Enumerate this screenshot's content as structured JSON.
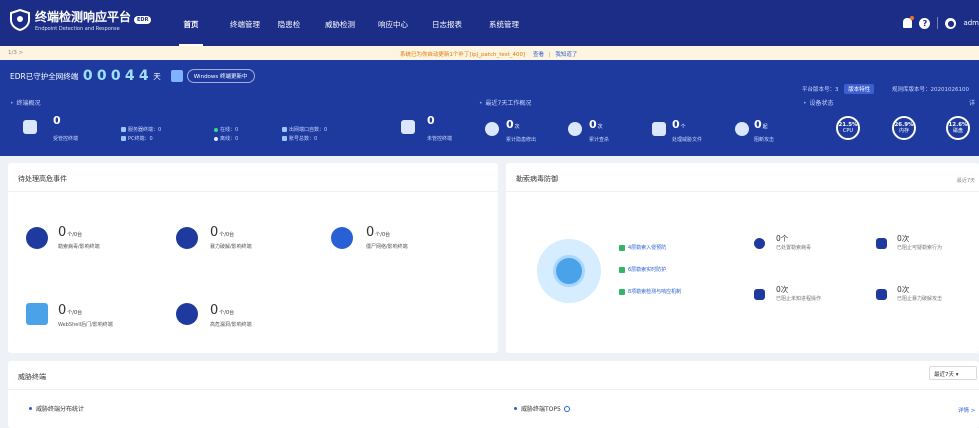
{
  "app": {
    "title": "终端检测响应平台",
    "badge": "EDR",
    "subtitle": "Endpoint Detection and Response"
  },
  "nav": [
    "首页",
    "终端管理",
    "隐患检",
    "威胁检测",
    "响应中心",
    "日志报表",
    "系统管理"
  ],
  "user": {
    "name": "adm"
  },
  "notice": {
    "page": "1/3 >",
    "message": "系统已为你自动更新1个补丁[ipj_patch_test_400]",
    "link1": "查看",
    "link2": "我知道了"
  },
  "banner": {
    "guard_label": "EDR已守护全网终端",
    "digits": [
      "0",
      "0",
      "0",
      "4",
      "4"
    ],
    "days": "天",
    "windows_pill": "Windows 终端更新中",
    "version_label": "平台版本号：3",
    "version_button": "版本特性",
    "rule_version": "规则库版本号：20201026100",
    "sections": {
      "endpoint": "终端概况",
      "last7": "最近7天工作概况",
      "device": "设备状态",
      "detail": "详"
    },
    "managed": {
      "value": "0",
      "label": "受管控终端"
    },
    "endpoint_rows": {
      "servers": "服务器终端：0",
      "pc": "PC终端：0",
      "online": "在线：0",
      "offline": "离线：0",
      "exposed": "出网端口自数：0",
      "accounts": "账号总数：0"
    },
    "unmanaged": {
      "value": "0",
      "label": "未管控终端"
    },
    "weekly": [
      {
        "value": "0",
        "unit": "次",
        "label": "累计隐患修出"
      },
      {
        "value": "0",
        "unit": "次",
        "label": "累计查杀"
      },
      {
        "value": "0",
        "unit": "个",
        "label": "处理威胁文件"
      },
      {
        "value": "0",
        "unit": "起",
        "label": "阻断攻击"
      }
    ],
    "rings": [
      {
        "value": "21.5%",
        "label": "CPU"
      },
      {
        "value": "26.9%",
        "label": "内存"
      },
      {
        "value": "12.6%",
        "label": "磁盘"
      }
    ]
  },
  "events": {
    "title": "待处理高危事件",
    "items": [
      {
        "value": "0",
        "unit": "个/0台",
        "label": "勒索病毒/影响终端",
        "color": "#1e3a9e"
      },
      {
        "value": "0",
        "unit": "个/0台",
        "label": "暴力破解/影响终端",
        "color": "#1e3a9e"
      },
      {
        "value": "0",
        "unit": "个/0台",
        "label": "僵尸网络/影响终端",
        "color": "#2a60d6"
      },
      {
        "value": "0",
        "unit": "个/0台",
        "label": "WebShell后门/影响终端",
        "color": "#4aa3e8"
      },
      {
        "value": "0",
        "unit": "个/0台",
        "label": "高危漏洞/影响终端",
        "color": "#1e3a9e"
      }
    ]
  },
  "ransom": {
    "title": "勒索病毒防御",
    "more": "最近7天",
    "defenses": [
      "4层勒索入侵预防",
      "6层勒索实时防护",
      "8项勒索检测与响应机制"
    ],
    "stats": [
      {
        "value": "0个",
        "label": "已处置勒索病毒"
      },
      {
        "value": "0次",
        "label": "已阻止可疑勒索行为"
      },
      {
        "value": "0次",
        "label": "已阻止未知进程操作"
      },
      {
        "value": "0次",
        "label": "已阻止暴力破解攻击"
      }
    ]
  },
  "threat": {
    "title": "威胁终端",
    "range": "最近7天",
    "distribution": "威胁终端分布统计",
    "top5": "威胁终端TOP5",
    "detail": "详情 >"
  },
  "colors": {
    "nav_bg": "#1b2d87",
    "banner_bg": "#1e3a9e",
    "accent": "#2a60d6"
  }
}
